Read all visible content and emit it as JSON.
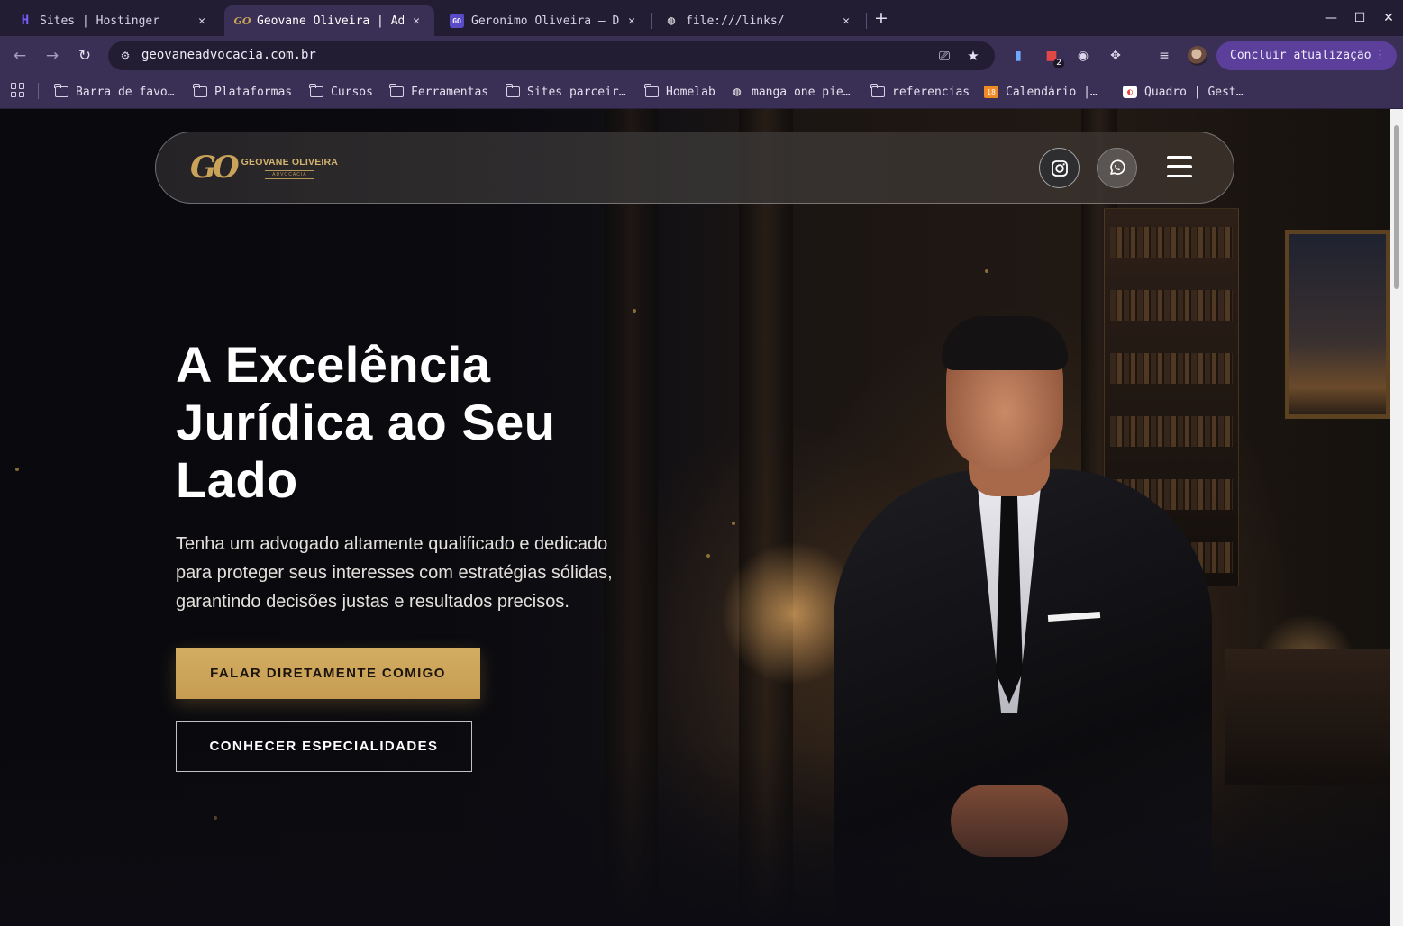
{
  "browser": {
    "tabs": [
      {
        "title": "Sites | Hostinger",
        "favicon": "hostinger-icon"
      },
      {
        "title": "Geovane Oliveira | Ad",
        "favicon": "go-logo-icon",
        "active": true
      },
      {
        "title": "Geronimo Oliveira — D",
        "favicon": "go-badge-icon"
      },
      {
        "title": "file:///links/",
        "favicon": "globe-icon"
      }
    ],
    "address": "geovaneadvocacia.com.br",
    "update_label": "Concluir atualização",
    "extension_badge": "2",
    "bookmarks": [
      {
        "label": "Barra de favo…",
        "icon": "folder-icon"
      },
      {
        "label": "Plataformas",
        "icon": "folder-icon"
      },
      {
        "label": "Cursos",
        "icon": "folder-icon"
      },
      {
        "label": "Ferramentas",
        "icon": "folder-icon"
      },
      {
        "label": "Sites parceir…",
        "icon": "folder-icon"
      },
      {
        "label": "Homelab",
        "icon": "folder-icon"
      },
      {
        "label": "manga one pie…",
        "icon": "globe-icon"
      },
      {
        "label": "referencias",
        "icon": "folder-icon"
      },
      {
        "label": "Calendário |…",
        "icon": "calendar-icon",
        "badge": "18"
      },
      {
        "label": "Quadro | Gest…",
        "icon": "board-icon"
      }
    ]
  },
  "site": {
    "logo": {
      "mark": "GO",
      "name": "GEOVANE OLIVEIRA",
      "sub": "ADVOCACIA"
    },
    "hero": {
      "title_lines": [
        "A Excelência",
        "Jurídica ao Seu",
        "Lado"
      ],
      "subtitle_lines": [
        "Tenha um advogado altamente qualificado e dedicado",
        "para proteger seus interesses com estratégias sólidas,",
        "garantindo decisões justas e resultados precisos."
      ],
      "primary_cta": "FALAR DIRETAMENTE COMIGO",
      "secondary_cta": "CONHECER ESPECIALIDADES"
    }
  },
  "colors": {
    "accent_gold": "#c9a35a",
    "browser_frame": "#3a2f55",
    "update_button": "#5b3f9a"
  }
}
